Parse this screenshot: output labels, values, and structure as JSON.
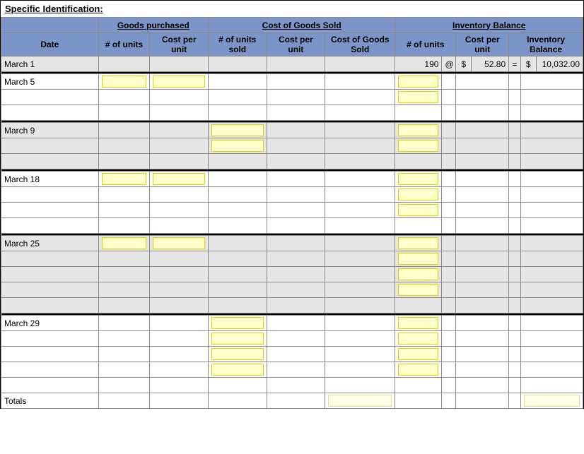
{
  "title": "Specific Identification:",
  "headers": {
    "group_goods": "Goods purchased",
    "group_cogs": "Cost of Goods Sold",
    "group_inv": "Inventory Balance",
    "date": "Date",
    "units": "# of units",
    "cost_per_unit": "Cost per unit",
    "units_sold": "# of units sold",
    "cogs": "Cost of Goods Sold",
    "inv_bal": "Inventory Balance"
  },
  "dates": {
    "m1": "March 1",
    "m5": "March 5",
    "m9": "March 9",
    "m18": "March 18",
    "m25": "March 25",
    "m29": "March 29",
    "totals": "Totals"
  },
  "row1": {
    "units": "190",
    "at": "@",
    "dollar": "$",
    "cost": "52.80",
    "eq": "=",
    "bal_dollar": "$",
    "balance": "10,032.00"
  }
}
